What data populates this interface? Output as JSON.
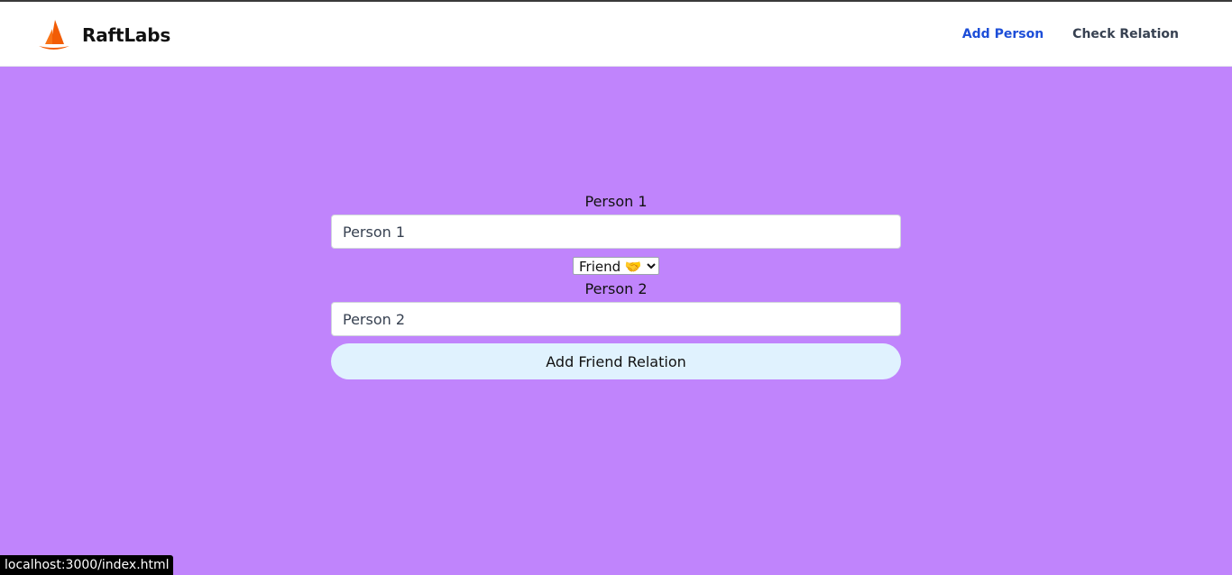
{
  "navbar": {
    "brand_name": "RaftLabs",
    "links": [
      {
        "label": "Add Person",
        "active": true
      },
      {
        "label": "Check Relation",
        "active": false
      }
    ]
  },
  "form": {
    "person1_label": "Person 1",
    "person1_placeholder": "Person 1",
    "relation_selected": "Friend 🤝",
    "person2_label": "Person 2",
    "person2_placeholder": "Person 2",
    "submit_label": "Add Friend Relation"
  },
  "status_bar": {
    "url": "localhost:3000/index.html"
  },
  "colors": {
    "page_background": "#c084fc",
    "active_link": "#1d4ed8",
    "button_background": "#e0f2fe",
    "logo_orange": "#f25c05"
  },
  "icons": {
    "logo": "sailboat-logo-icon",
    "select_caret": "chevron-down-icon"
  }
}
